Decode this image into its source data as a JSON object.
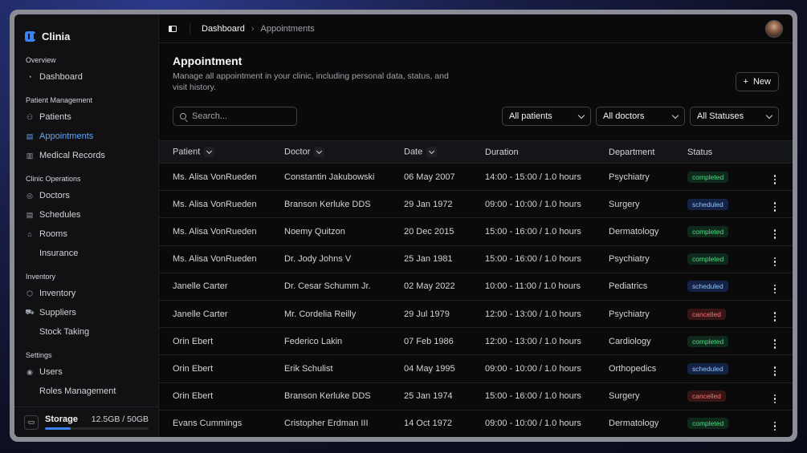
{
  "app": {
    "name": "Clinia"
  },
  "sidebar": {
    "groups": [
      {
        "label": "Overview",
        "items": [
          {
            "label": "Dashboard",
            "icon": "gauge-icon"
          }
        ]
      },
      {
        "label": "Patient Management",
        "items": [
          {
            "label": "Patients",
            "icon": "users-icon"
          },
          {
            "label": "Appointments",
            "icon": "calendar-icon",
            "active": true
          },
          {
            "label": "Medical Records",
            "icon": "book-icon"
          }
        ]
      },
      {
        "label": "Clinic Operations",
        "items": [
          {
            "label": "Doctors",
            "icon": "stethoscope-icon"
          },
          {
            "label": "Schedules",
            "icon": "calendar-icon"
          },
          {
            "label": "Rooms",
            "icon": "building-icon"
          },
          {
            "label": "Insurance",
            "icon": ""
          }
        ]
      },
      {
        "label": "Inventory",
        "items": [
          {
            "label": "Inventory",
            "icon": "box-icon"
          },
          {
            "label": "Suppliers",
            "icon": "truck-icon"
          },
          {
            "label": "Stock Taking",
            "icon": ""
          }
        ]
      },
      {
        "label": "Settings",
        "items": [
          {
            "label": "Users",
            "icon": "user-circle-icon"
          },
          {
            "label": "Roles Management",
            "icon": ""
          }
        ]
      }
    ],
    "storage": {
      "label": "Storage",
      "value": "12.5GB / 50GB",
      "fraction": 0.25
    }
  },
  "topbar": {
    "breadcrumb": [
      "Dashboard",
      "Appointments"
    ]
  },
  "page": {
    "title": "Appointment",
    "description": "Manage all appointment in your clinic, including personal data, status, and visit history.",
    "new_label": "New"
  },
  "filters": {
    "search_placeholder": "Search...",
    "patients": "All patients",
    "doctors": "All doctors",
    "statuses": "All Statuses"
  },
  "table": {
    "columns": [
      "Patient",
      "Doctor",
      "Date",
      "Duration",
      "Department",
      "Status"
    ],
    "rows": [
      [
        "Ms. Alisa VonRueden",
        "Constantin Jakubowski",
        "06 May 2007",
        "14:00 - 15:00 / 1.0 hours",
        "Psychiatry",
        "completed"
      ],
      [
        "Ms. Alisa VonRueden",
        "Branson Kerluke DDS",
        "29 Jan 1972",
        "09:00 - 10:00 / 1.0 hours",
        "Surgery",
        "scheduled"
      ],
      [
        "Ms. Alisa VonRueden",
        "Noemy Quitzon",
        "20 Dec 2015",
        "15:00 - 16:00 / 1.0 hours",
        "Dermatology",
        "completed"
      ],
      [
        "Ms. Alisa VonRueden",
        "Dr. Jody Johns V",
        "25 Jan 1981",
        "15:00 - 16:00 / 1.0 hours",
        "Psychiatry",
        "completed"
      ],
      [
        "Janelle Carter",
        "Dr. Cesar Schumm Jr.",
        "02 May 2022",
        "10:00 - 11:00 / 1.0 hours",
        "Pediatrics",
        "scheduled"
      ],
      [
        "Janelle Carter",
        "Mr. Cordelia Reilly",
        "29 Jul 1979",
        "12:00 - 13:00 / 1.0 hours",
        "Psychiatry",
        "cancelled"
      ],
      [
        "Orin Ebert",
        "Federico Lakin",
        "07 Feb 1986",
        "12:00 - 13:00 / 1.0 hours",
        "Cardiology",
        "completed"
      ],
      [
        "Orin Ebert",
        "Erik Schulist",
        "04 May 1995",
        "09:00 - 10:00 / 1.0 hours",
        "Orthopedics",
        "scheduled"
      ],
      [
        "Orin Ebert",
        "Branson Kerluke DDS",
        "25 Jan 1974",
        "15:00 - 16:00 / 1.0 hours",
        "Surgery",
        "cancelled"
      ],
      [
        "Evans Cummings",
        "Cristopher Erdman III",
        "14 Oct 1972",
        "09:00 - 10:00 / 1.0 hours",
        "Dermatology",
        "completed"
      ]
    ]
  }
}
